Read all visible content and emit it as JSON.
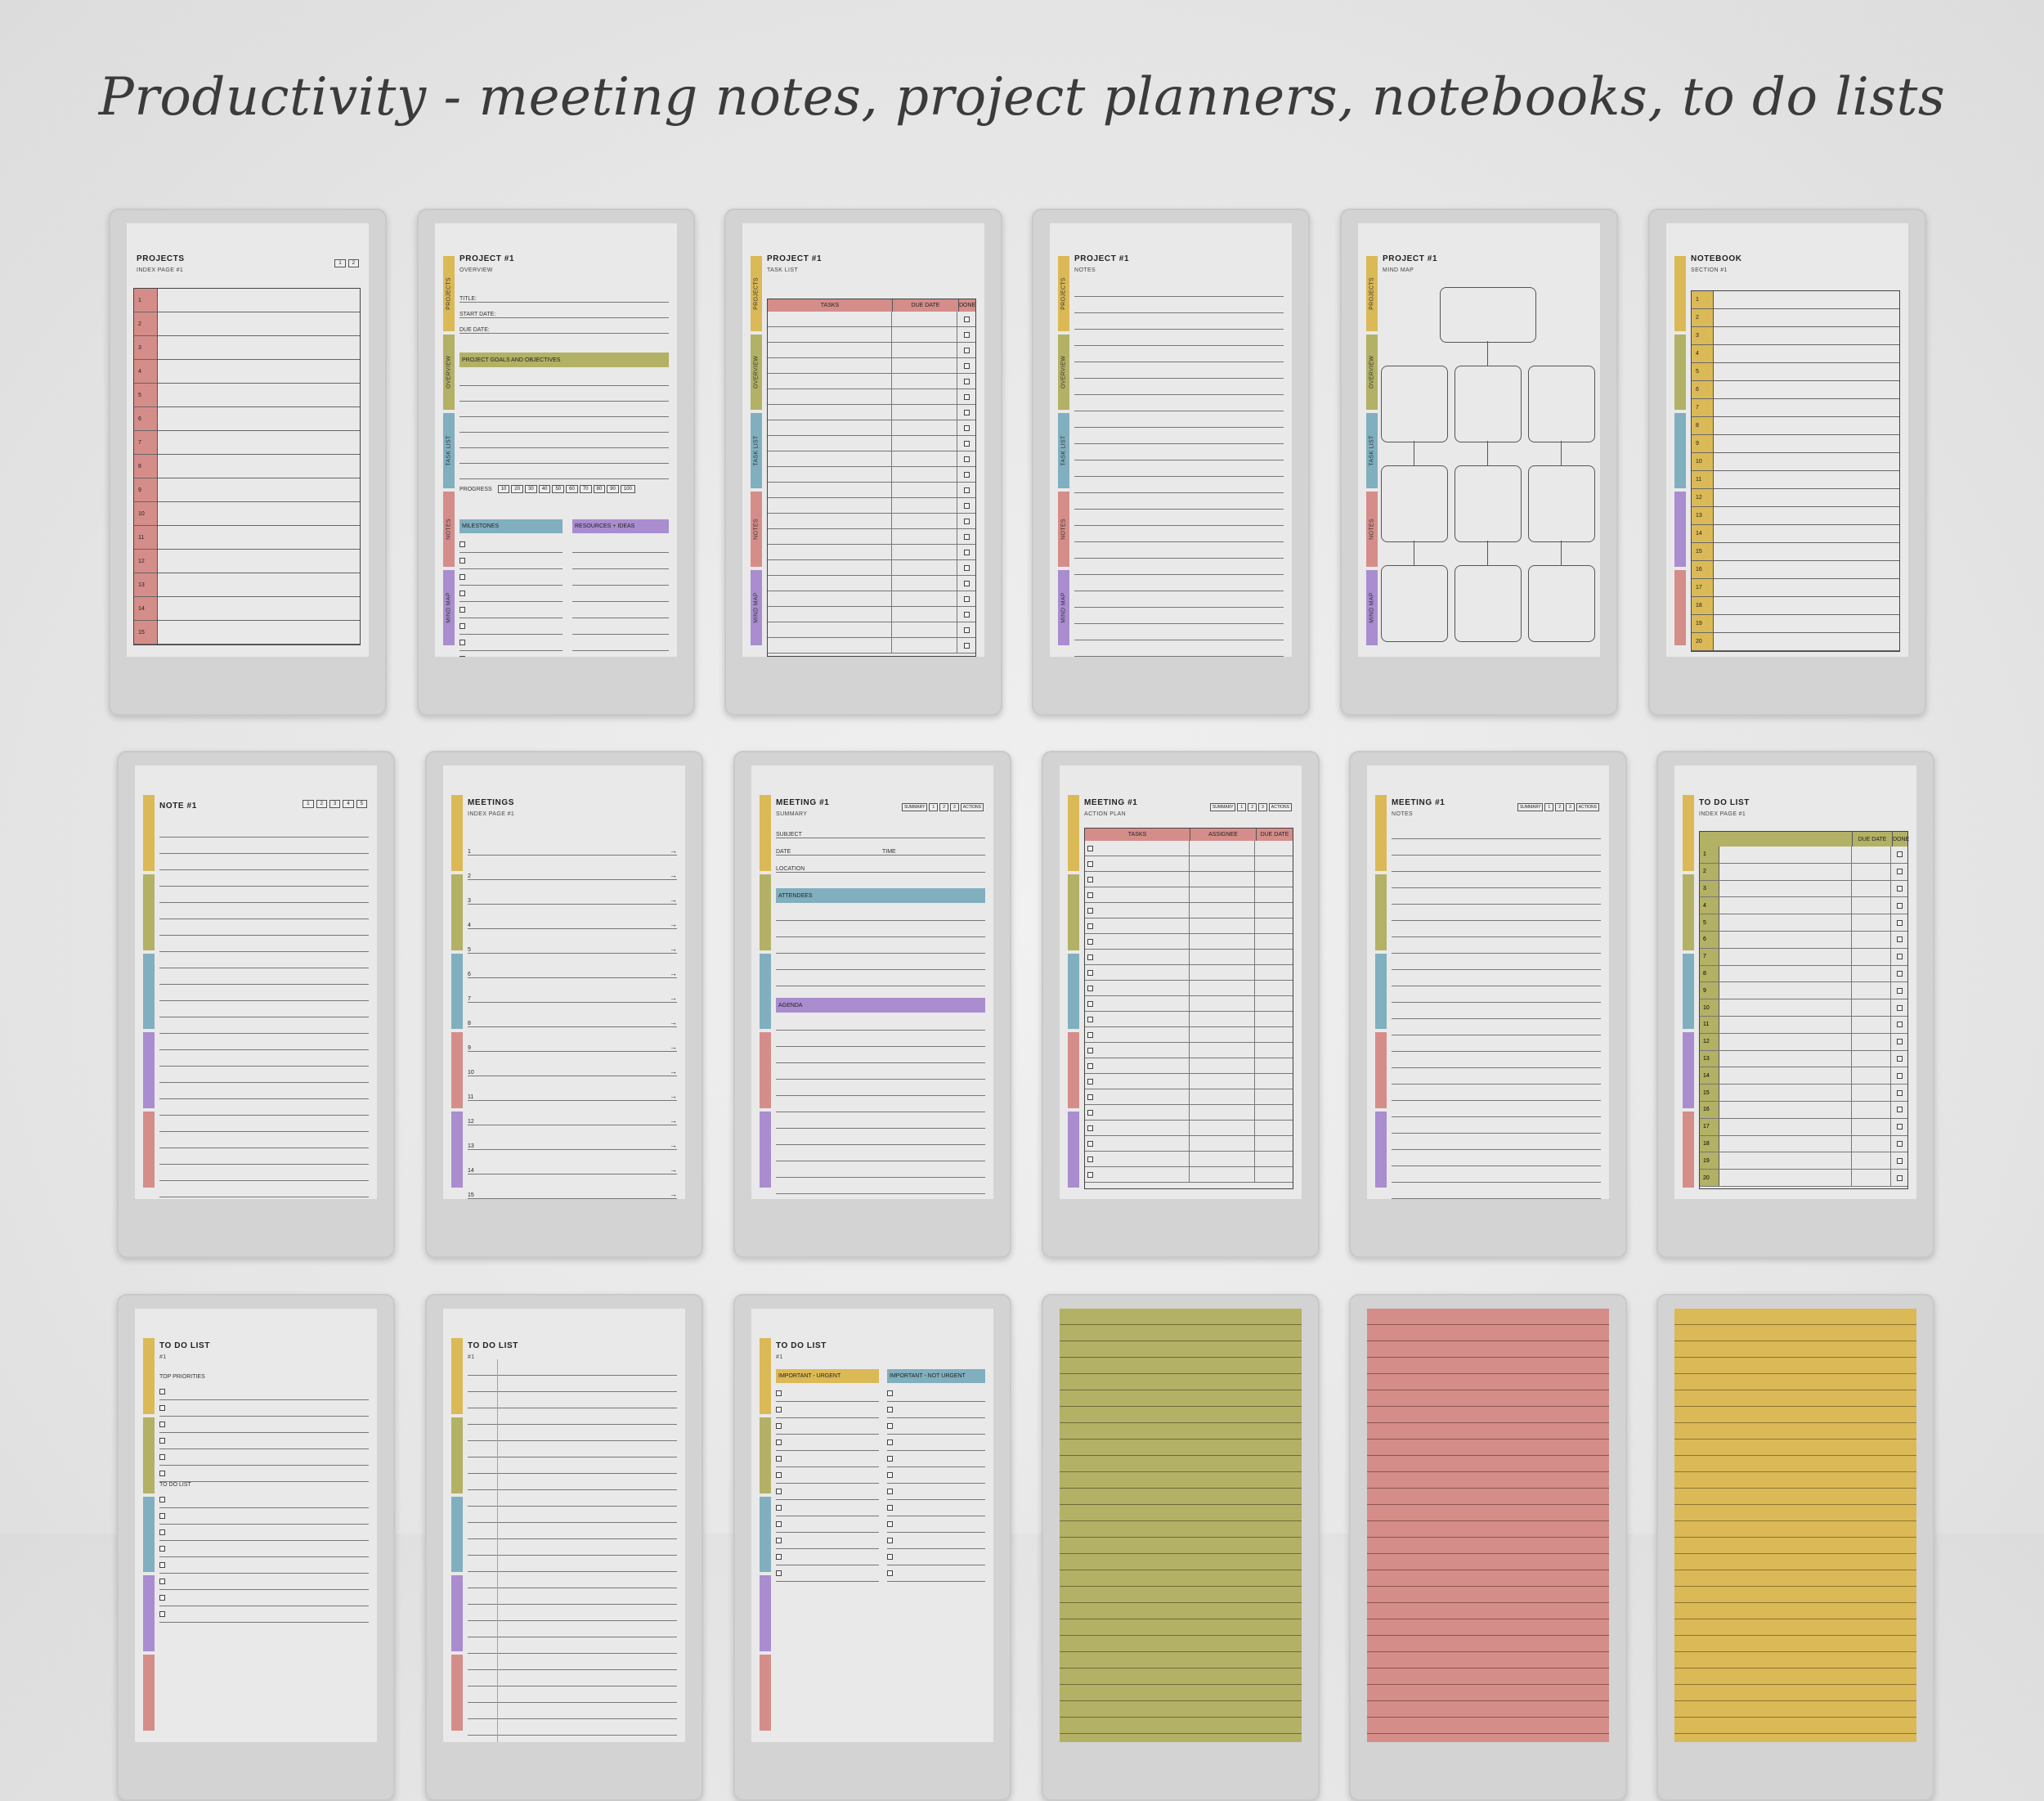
{
  "title": "Productivity - meeting notes, project planners, notebooks, to do lists",
  "colors": {
    "yellow": "#dbb956",
    "olive": "#b2b165",
    "blue": "#80afbf",
    "red": "#d58d89",
    "purple": "#a98dcf",
    "device": "#d3d3d3",
    "paper": "#e9e9e9"
  },
  "tabs": [
    "PROJECTS",
    "OVERVIEW",
    "TASK LIST",
    "NOTES",
    "MIND MAP"
  ],
  "pages": {
    "projects_index": {
      "title": "PROJECTS",
      "subtitle": "INDEX PAGE #1",
      "page_buttons": [
        "1",
        "2"
      ],
      "numbers": [
        "1",
        "2",
        "3",
        "4",
        "5",
        "6",
        "7",
        "8",
        "9",
        "10",
        "11",
        "12",
        "13",
        "14",
        "15"
      ]
    },
    "project_overview": {
      "title": "PROJECT #1",
      "subtitle": "OVERVIEW",
      "fields": [
        "TITLE:",
        "START DATE:",
        "DUE DATE:"
      ],
      "goals": "PROJECT GOALS AND OBJECTIVES",
      "progress_label": "PROGRESS",
      "progress_steps": [
        "10",
        "20",
        "30",
        "40",
        "50",
        "60",
        "70",
        "80",
        "90",
        "100"
      ],
      "milestones": "MILESTONES",
      "resources": "RESOURCES + IDEAS"
    },
    "project_tasks": {
      "title": "PROJECT #1",
      "subtitle": "TASK LIST",
      "columns": [
        "TASKS",
        "DUE DATE",
        "DONE"
      ]
    },
    "project_notes": {
      "title": "PROJECT #1",
      "subtitle": "NOTES"
    },
    "project_mindmap": {
      "title": "PROJECT #1",
      "subtitle": "MIND MAP"
    },
    "notebook": {
      "title": "NOTEBOOK",
      "subtitle": "SECTION #1",
      "numbers": [
        "1",
        "2",
        "3",
        "4",
        "5",
        "6",
        "7",
        "8",
        "9",
        "10",
        "11",
        "12",
        "13",
        "14",
        "15",
        "16",
        "17",
        "18",
        "19",
        "20"
      ]
    },
    "note": {
      "title": "NOTE #1",
      "page_buttons": [
        "1",
        "2",
        "3",
        "4",
        "5"
      ]
    },
    "meetings_index": {
      "title": "MEETINGS",
      "subtitle": "INDEX PAGE #1",
      "numbers": [
        "1",
        "2",
        "3",
        "4",
        "5",
        "6",
        "7",
        "8",
        "9",
        "10",
        "11",
        "12",
        "13",
        "14",
        "15"
      ]
    },
    "meeting_summary": {
      "title": "MEETING #1",
      "subtitle": "SUMMARY",
      "page_buttons": [
        "SUMMARY",
        "1",
        "2",
        "3",
        "ACTIONS"
      ],
      "subject": "SUBJECT",
      "date": "DATE",
      "time": "TIME",
      "location": "LOCATION",
      "attendees": "ATTENDEES",
      "agenda": "AGENDA"
    },
    "meeting_action": {
      "title": "MEETING #1",
      "subtitle": "ACTION PLAN",
      "page_buttons": [
        "SUMMARY",
        "1",
        "2",
        "3",
        "ACTIONS"
      ],
      "columns": [
        "TASKS",
        "ASSIGNEE",
        "DUE DATE"
      ]
    },
    "meeting_notes": {
      "title": "MEETING #1",
      "subtitle": "NOTES",
      "page_buttons": [
        "SUMMARY",
        "1",
        "2",
        "3",
        "ACTIONS"
      ]
    },
    "todo_index": {
      "title": "TO DO LIST",
      "subtitle": "INDEX PAGE #1",
      "columns": [
        "DUE DATE",
        "DONE"
      ],
      "numbers": [
        "1",
        "2",
        "3",
        "4",
        "5",
        "6",
        "7",
        "8",
        "9",
        "10",
        "11",
        "12",
        "13",
        "14",
        "15",
        "16",
        "17",
        "18",
        "19",
        "20"
      ]
    },
    "todo_priorities": {
      "title": "TO DO LIST",
      "subtitle": "#1",
      "top_priorities": "TOP PRIORITIES",
      "todo_list": "TO DO LIST"
    },
    "todo_lined": {
      "title": "TO DO LIST",
      "subtitle": "#1"
    },
    "todo_matrix": {
      "title": "TO DO LIST",
      "subtitle": "#1",
      "urgent": "IMPORTANT - URGENT",
      "not_urgent": "IMPORTANT - NOT URGENT"
    }
  }
}
